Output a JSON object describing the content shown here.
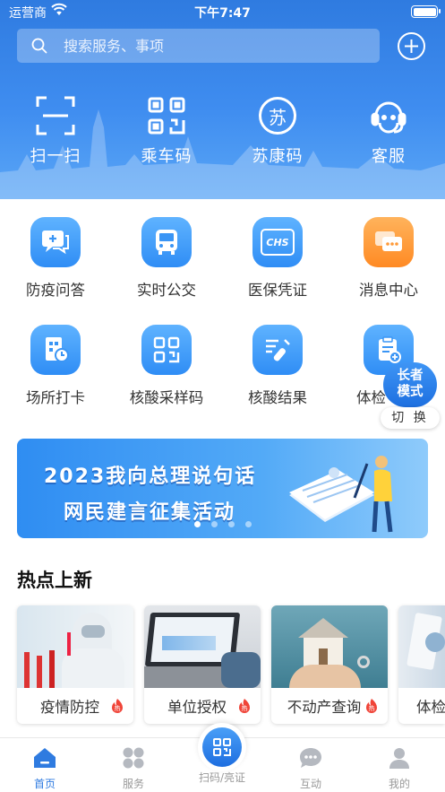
{
  "status_bar": {
    "carrier": "运营商",
    "time": "下午7:47"
  },
  "search": {
    "placeholder": "搜索服务、事项"
  },
  "quick_actions": [
    {
      "label": "扫一扫",
      "icon": "scan-icon"
    },
    {
      "label": "乘车码",
      "icon": "qr-code-icon"
    },
    {
      "label": "苏康码",
      "icon": "su-health-code-icon",
      "glyph": "苏"
    },
    {
      "label": "客服",
      "icon": "customer-service-icon"
    }
  ],
  "services": [
    {
      "label": "防疫问答",
      "icon": "chat-plus-icon"
    },
    {
      "label": "实时公交",
      "icon": "bus-icon"
    },
    {
      "label": "医保凭证",
      "icon": "chs-medical-insurance-icon",
      "badge_text": "CHS"
    },
    {
      "label": "消息中心",
      "icon": "message-icon"
    },
    {
      "label": "场所打卡",
      "icon": "venue-checkin-icon"
    },
    {
      "label": "核酸采样码",
      "icon": "sampling-qr-icon"
    },
    {
      "label": "核酸结果",
      "icon": "test-result-icon"
    },
    {
      "label": "体检",
      "icon": "health-check-icon"
    }
  ],
  "elder_mode": {
    "line1": "长者",
    "line2": "模式",
    "switch": "切 换"
  },
  "banner": {
    "line1": "2023我向总理说句话",
    "line2": "网民建言征集活动",
    "total_slides": 4,
    "active_slide": 1
  },
  "hot_section": {
    "title": "热点上新",
    "badge": "热",
    "cards": [
      {
        "label": "疫情防控",
        "hot": true
      },
      {
        "label": "单位授权",
        "hot": true
      },
      {
        "label": "不动产查询",
        "hot": true
      },
      {
        "label": "体检",
        "hot": false
      }
    ]
  },
  "tabs": [
    {
      "label": "首页",
      "icon": "home-icon",
      "active": true
    },
    {
      "label": "服务",
      "icon": "services-grid-icon",
      "active": false
    },
    {
      "label": "扫码/亮证",
      "icon": "scan-qr-icon",
      "active": false
    },
    {
      "label": "互动",
      "icon": "chat-bubble-icon",
      "active": false
    },
    {
      "label": "我的",
      "icon": "profile-icon",
      "active": false
    }
  ],
  "colors": {
    "primary": "#2f7be0",
    "accent_orange": "#ff8a24",
    "hot_red": "#f04438"
  }
}
